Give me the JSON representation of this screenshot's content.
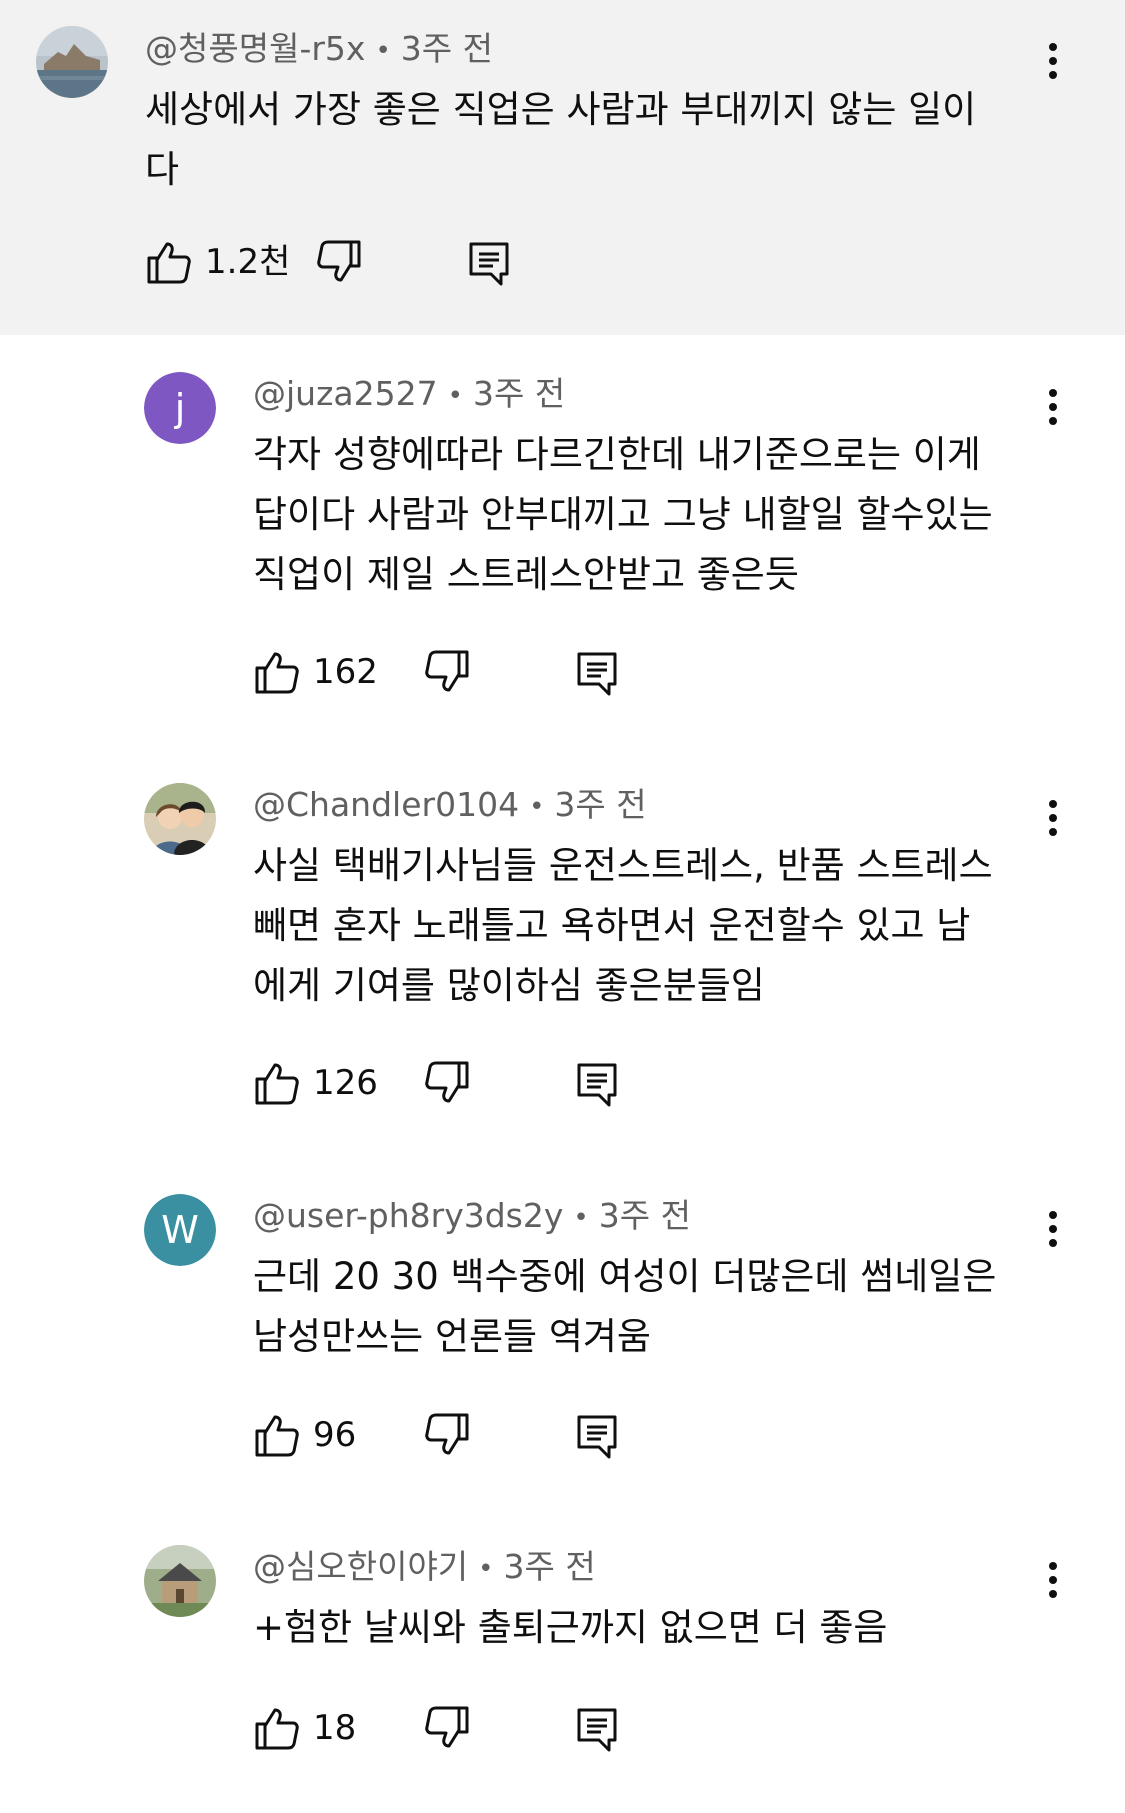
{
  "comments": [
    {
      "handle": "@청풍명월-r5x",
      "time": "3주 전",
      "lines": [
        "세상에서 가장 좋은 직업은 사람과 부대끼지 않는 일이",
        "다"
      ],
      "likes": "1.2천",
      "avatar": {
        "type": "image",
        "desc": "landscape"
      },
      "highlighted": true
    },
    {
      "handle": "@juza2527",
      "time": "3주 전",
      "lines": [
        "각자 성향에따라 다르긴한데 내기준으로는 이게",
        "답이다 사람과 안부대끼고 그냥 내할일 할수있는",
        "직업이 제일 스트레스안받고 좋은듯"
      ],
      "likes": "162",
      "avatar": {
        "type": "letter",
        "letter": "j",
        "color": "#7e57c2"
      }
    },
    {
      "handle": "@Chandler0104",
      "time": "3주 전",
      "lines": [
        "사실 택배기사님들 운전스트레스, 반품 스트레스",
        "빼면 혼자 노래틀고 욕하면서 운전할수 있고 남",
        "에게 기여를 많이하심 좋은분들임"
      ],
      "likes": "126",
      "avatar": {
        "type": "image",
        "desc": "couple"
      }
    },
    {
      "handle": "@user-ph8ry3ds2y",
      "time": "3주 전",
      "lines": [
        "근데 20 30 백수중에 여성이 더많은데 썸네일은",
        "남성만쓰는 언론들 역겨움"
      ],
      "likes": "96",
      "avatar": {
        "type": "letter",
        "letter": "W",
        "color": "#3a8fa0"
      }
    },
    {
      "handle": "@심오한이야기",
      "time": "3주 전",
      "lines": [
        "+험한 날씨와 출퇴근까지 없으면 더 좋음"
      ],
      "likes": "18",
      "avatar": {
        "type": "image",
        "desc": "house"
      }
    }
  ],
  "icons": {
    "like": "thumbs-up-icon",
    "dislike": "thumbs-down-icon",
    "reply": "reply-comment-icon",
    "more": "more-vertical-icon"
  },
  "colors": {
    "highlight_bg": "#f2f2f2",
    "meta_text": "#606060",
    "body_text": "#0f0f0f"
  }
}
